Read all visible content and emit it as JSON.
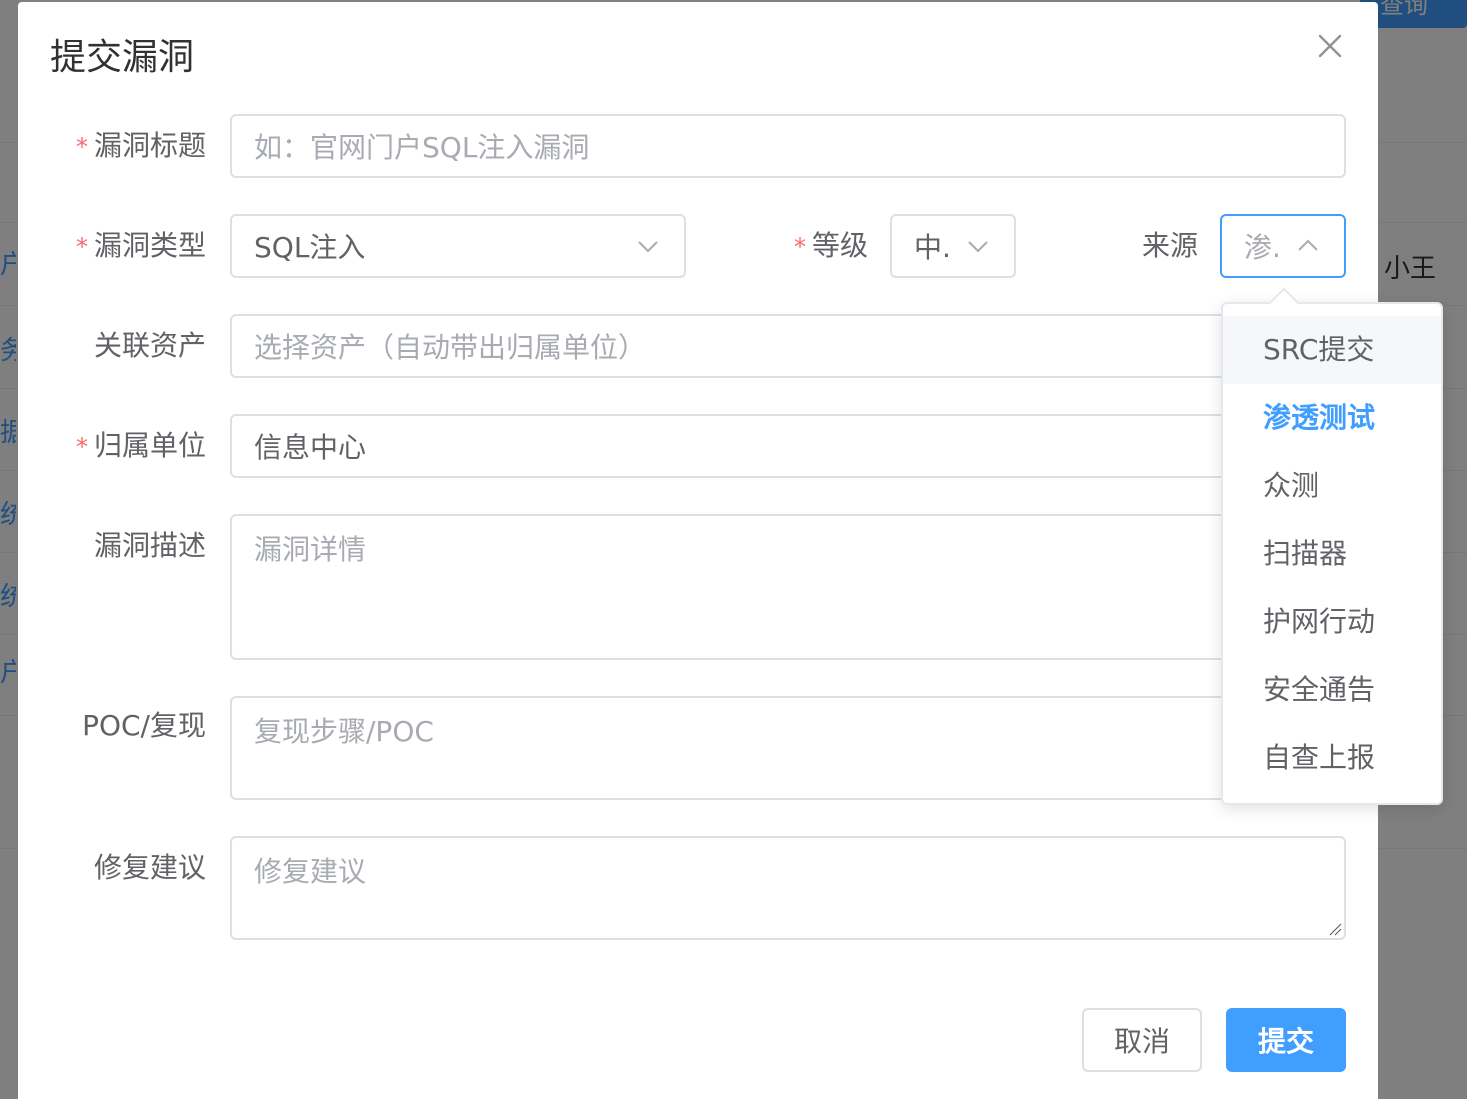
{
  "dialog": {
    "title": "提交漏洞",
    "close_icon": "close-icon"
  },
  "form": {
    "title": {
      "label": "漏洞标题",
      "required": true,
      "placeholder": "如：官网门户SQL注入漏洞",
      "value": ""
    },
    "type": {
      "label": "漏洞类型",
      "required": true,
      "value": "SQL注入",
      "icon": "chevron-down-icon"
    },
    "level": {
      "label": "等级",
      "required": true,
      "value": "中.",
      "icon": "chevron-down-icon"
    },
    "source": {
      "label": "来源",
      "required": false,
      "value": "渗.",
      "icon": "chevron-up-icon",
      "open": true
    },
    "asset": {
      "label": "关联资产",
      "required": false,
      "placeholder": "选择资产（自动带出归属单位）"
    },
    "unit": {
      "label": "归属单位",
      "required": true,
      "value": "信息中心"
    },
    "description": {
      "label": "漏洞描述",
      "required": false,
      "placeholder": "漏洞详情"
    },
    "poc": {
      "label": "POC/复现",
      "required": false,
      "placeholder": "复现步骤/POC"
    },
    "fix": {
      "label": "修复建议",
      "required": false,
      "placeholder": "修复建议"
    },
    "required_mark": "*"
  },
  "source_options": {
    "items": [
      {
        "label": "SRC提交",
        "state": "hover"
      },
      {
        "label": "渗透测试",
        "state": "selected"
      },
      {
        "label": "众测",
        "state": ""
      },
      {
        "label": "扫描器",
        "state": ""
      },
      {
        "label": "护网行动",
        "state": ""
      },
      {
        "label": "安全通告",
        "state": ""
      },
      {
        "label": "自查上报",
        "state": ""
      }
    ]
  },
  "footer": {
    "cancel_label": "取消",
    "submit_label": "提交"
  },
  "background": {
    "query_button": "查询",
    "right_text": "小王",
    "left_texts": [
      "户",
      "务",
      "据",
      "统",
      "统",
      "户"
    ]
  },
  "colors": {
    "primary": "#409eff",
    "required": "#f56c6c",
    "text": "#606266",
    "placeholder": "#a8abb2",
    "border": "#dcdfe6"
  }
}
